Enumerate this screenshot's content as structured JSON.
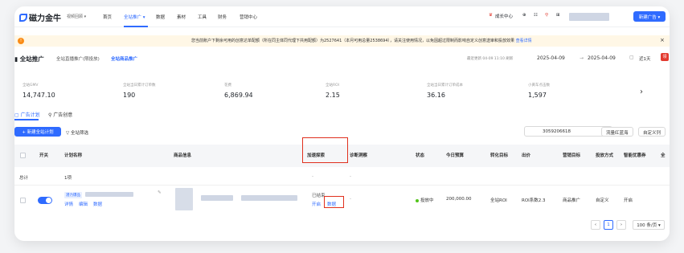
{
  "nav": {
    "brand": "磁力金牛",
    "brand_sub": "视频回顾 ▾",
    "items": [
      "首页",
      "全站推广 ▾",
      "数据",
      "素材",
      "工具",
      "财务",
      "营销中心"
    ],
    "growth": "成长中心",
    "icons": [
      "⊕",
      "☷",
      "⚲",
      "⊞"
    ],
    "new_button": "新建广告 ▾"
  },
  "notice": {
    "icon": "!",
    "text": "您当前账户下剩余可用的创意达单配额（所在同主体同代理下共用配额）为2527641（本月可用总量2538694），请关注使用情况，以免因超过限制而影响自定义创意送审和投放效果",
    "link": "查看详情",
    "close": "×"
  },
  "header": {
    "title": "全站推广",
    "tabs": [
      "全站直播推广(限投放)",
      "全站商品推广"
    ],
    "updated": "最近更新 04-09 11:10 刷新",
    "date_start": "2025-04-09",
    "date_sep": "→",
    "date_end": "2025-04-09",
    "calendar_icon": "▢",
    "range_label": "近1天",
    "gift": "领"
  },
  "metrics": [
    {
      "label": "全站GMV",
      "value": "14,747.10"
    },
    {
      "label": "全站当日累计订单数",
      "value": "190"
    },
    {
      "label": "花费",
      "value": "6,869.94"
    },
    {
      "label": "全站ROI",
      "value": "2.15"
    },
    {
      "label": "全站当日累计订单成本",
      "value": "36.16"
    },
    {
      "label": "小黄车点击数",
      "value": "1,597"
    }
  ],
  "metrics_chevron": "›",
  "subtabs": [
    "▢ 广告计划",
    "⚲ 广告创意"
  ],
  "toolbar": {
    "new_plan": "+ 新建全站计划",
    "filter": "▽ 全站筛选",
    "search_value": "3059206618",
    "search_icon": "⌕",
    "btn_traffic": "流量红蓝海",
    "btn_custom": "自定义列"
  },
  "table": {
    "headers": [
      "开关",
      "计划名称",
      "商品信息",
      "加速探索",
      "诊断洞察",
      "状态",
      "今日预算",
      "转化目标",
      "出价",
      "营销目标",
      "投放方式",
      "智能优惠券",
      "全"
    ],
    "total_label": "总计",
    "total_count": "1项",
    "total_dash_1": "-",
    "total_dash_2": "-",
    "row": {
      "tag": "潜力爆品",
      "actions": [
        "详情",
        "编辑",
        "数据"
      ],
      "edit_icon": "✎",
      "accel_status": "已结束",
      "accel_links": [
        "开启",
        "数据"
      ],
      "diag": "-",
      "status": "投放中",
      "budget": "200,000.00",
      "conv_goal": "全站ROI",
      "bid": "ROI系数2.3",
      "marketing": "商品推广",
      "delivery": "自定义",
      "coupon": "开启"
    }
  },
  "pagination": {
    "prev": "‹",
    "current": "1",
    "next": "›",
    "page_size": "100 条/页 ▾"
  },
  "colors": {
    "accent": "#2f6bff",
    "highlight": "#e0301e",
    "notice_bg": "#fff7e6"
  }
}
